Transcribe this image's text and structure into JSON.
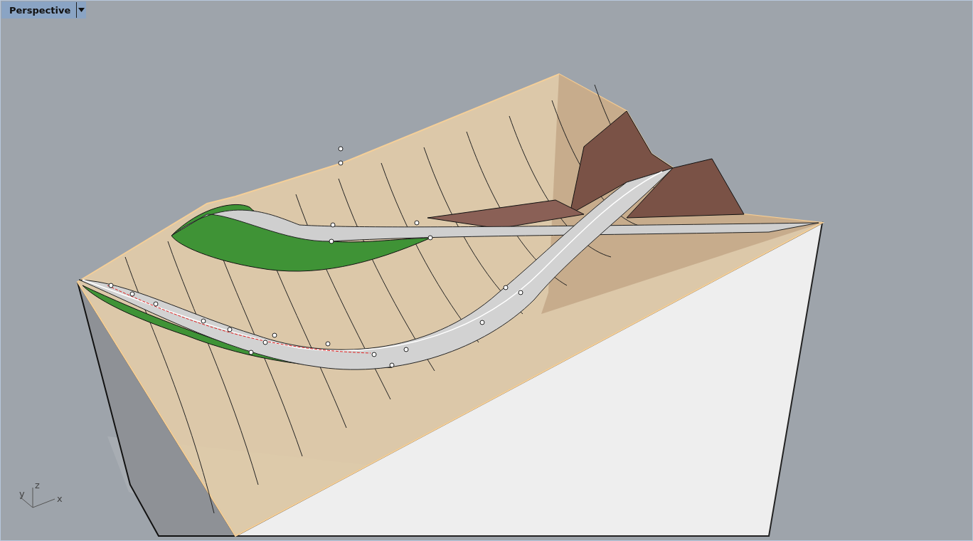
{
  "viewport": {
    "title": "Perspective"
  },
  "axes": [
    {
      "label": "y"
    },
    {
      "label": "z"
    },
    {
      "label": "x"
    }
  ]
}
